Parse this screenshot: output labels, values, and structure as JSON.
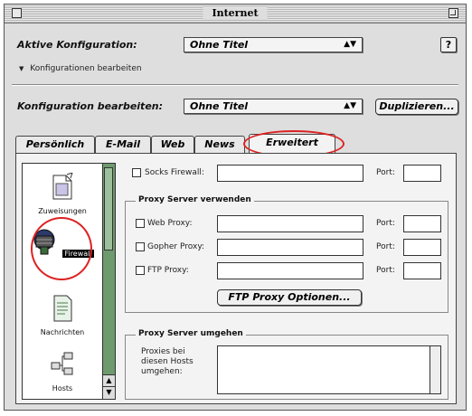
{
  "window": {
    "title": "Internet"
  },
  "config": {
    "active_label": "Aktive Konfiguration:",
    "active_value": "Ohne Titel",
    "disclosure_label": "Konfigurationen bearbeiten",
    "edit_label": "Konfiguration bearbeiten:",
    "edit_value": "Ohne Titel",
    "duplicate_label": "Duplizieren..."
  },
  "help_label": "?",
  "tabs": [
    {
      "label": "Persönlich"
    },
    {
      "label": "E-Mail"
    },
    {
      "label": "Web"
    },
    {
      "label": "News"
    },
    {
      "label": "Erweitert"
    }
  ],
  "sidebar": {
    "items": [
      {
        "label": "Zuweisungen",
        "icon": "document-icon"
      },
      {
        "label": "Firewall",
        "icon": "firewall-icon"
      },
      {
        "label": "Nachrichten",
        "icon": "message-icon"
      },
      {
        "label": "Hosts",
        "icon": "network-icon"
      }
    ]
  },
  "socks": {
    "label": "Socks Firewall:",
    "value": "",
    "port_label": "Port:",
    "port_value": ""
  },
  "proxy_group": {
    "title": "Proxy Server verwenden",
    "rows": [
      {
        "label": "Web Proxy:",
        "value": "",
        "port_label": "Port:",
        "port_value": ""
      },
      {
        "label": "Gopher Proxy:",
        "value": "",
        "port_label": "Port:",
        "port_value": ""
      },
      {
        "label": "FTP Proxy:",
        "value": "",
        "port_label": "Port:",
        "port_value": ""
      }
    ],
    "ftp_options_label": "FTP Proxy Optionen..."
  },
  "bypass_group": {
    "title": "Proxy Server umgehen",
    "description": "Proxies bei diesen Hosts umgehen:",
    "value": ""
  },
  "colors": {
    "highlight_oval": "#dd2222",
    "sidebar_scroll": "#6e9a6e"
  }
}
